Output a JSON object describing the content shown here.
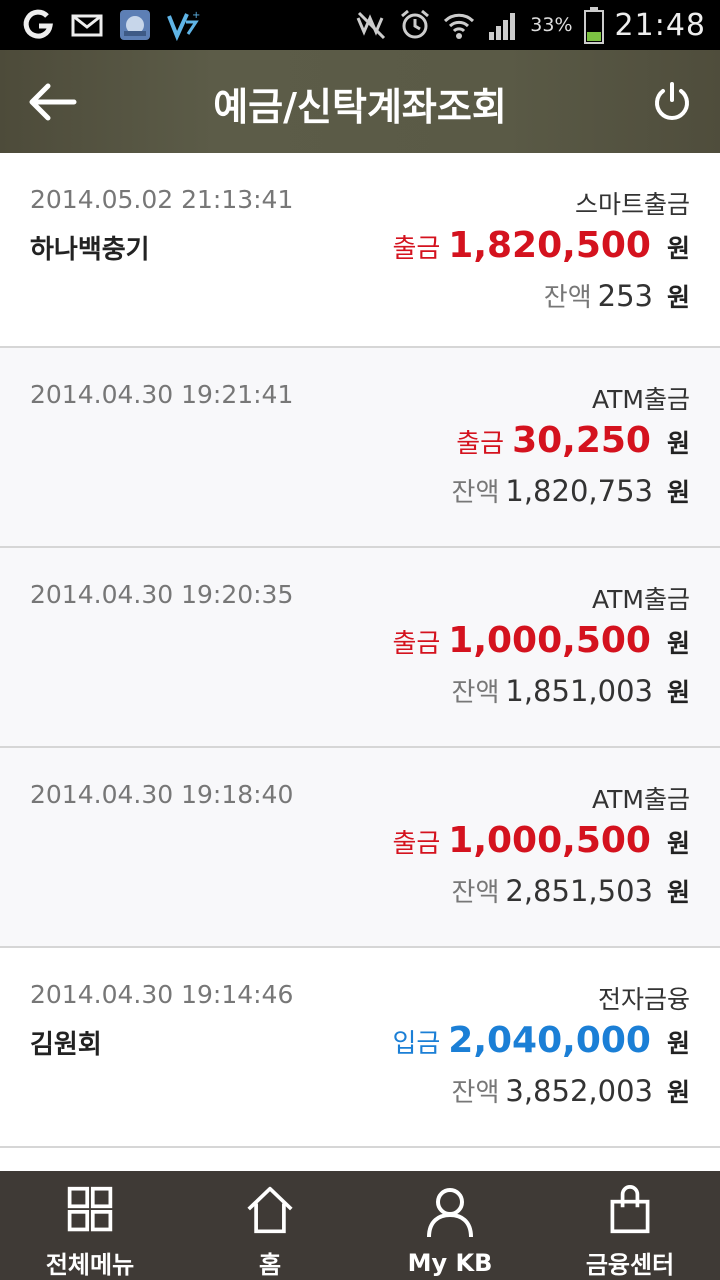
{
  "status_bar": {
    "battery_pct": "33%",
    "time": "21:48",
    "icons": [
      "g-app-icon",
      "mail-icon",
      "gallery-app-icon",
      "v3-app-icon",
      "mute-icon",
      "alarm-icon",
      "wifi-icon",
      "signal-icon",
      "battery-icon"
    ]
  },
  "header": {
    "title": "예금/신탁계좌조회",
    "back_icon": "back-arrow-icon",
    "power_icon": "power-icon"
  },
  "transactions": [
    {
      "datetime": "2014.05.02 21:13:41",
      "type": "스마트출금",
      "name": "하나백충기",
      "kind": "출금",
      "amount": "1,820,500",
      "unit": "원",
      "balance_label": "잔액",
      "balance": "253",
      "balance_unit": "원"
    },
    {
      "datetime": "2014.04.30 19:21:41",
      "type": "ATM출금",
      "name": "",
      "kind": "출금",
      "amount": "30,250",
      "unit": "원",
      "balance_label": "잔액",
      "balance": "1,820,753",
      "balance_unit": "원"
    },
    {
      "datetime": "2014.04.30 19:20:35",
      "type": "ATM출금",
      "name": "",
      "kind": "출금",
      "amount": "1,000,500",
      "unit": "원",
      "balance_label": "잔액",
      "balance": "1,851,003",
      "balance_unit": "원"
    },
    {
      "datetime": "2014.04.30 19:18:40",
      "type": "ATM출금",
      "name": "",
      "kind": "출금",
      "amount": "1,000,500",
      "unit": "원",
      "balance_label": "잔액",
      "balance": "2,851,503",
      "balance_unit": "원"
    },
    {
      "datetime": "2014.04.30 19:14:46",
      "type": "전자금융",
      "name": "김원회",
      "kind": "입금",
      "amount": "2,040,000",
      "unit": "원",
      "balance_label": "잔액",
      "balance": "3,852,003",
      "balance_unit": "원"
    }
  ],
  "colors": {
    "withdraw": "#d4121e",
    "deposit": "#1b7fd6",
    "nav_bg": "#3f3a36"
  },
  "bottom_nav": [
    {
      "label": "전체메뉴",
      "icon": "grid-menu-icon"
    },
    {
      "label": "홈",
      "icon": "home-icon"
    },
    {
      "label": "My KB",
      "icon": "person-icon"
    },
    {
      "label": "금융센터",
      "icon": "shopping-bag-icon"
    }
  ]
}
